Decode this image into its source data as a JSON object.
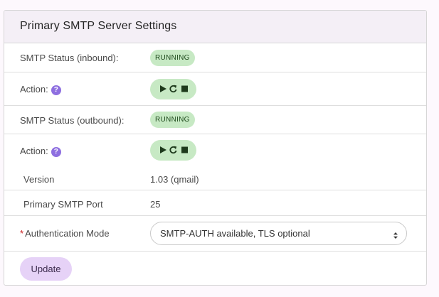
{
  "panel": {
    "title": "Primary SMTP Server Settings"
  },
  "rows": {
    "inbound": {
      "label": "SMTP Status (inbound):",
      "status": "RUNNING",
      "status_color": "#c7e9c4"
    },
    "inbound_action": {
      "label": "Action:",
      "help_glyph": "?",
      "icons": [
        "play-icon",
        "restart-icon",
        "stop-icon"
      ]
    },
    "outbound": {
      "label": "SMTP Status (outbound):",
      "status": "RUNNING",
      "status_color": "#c7e9c4"
    },
    "outbound_action": {
      "label": "Action:",
      "help_glyph": "?",
      "icons": [
        "play-icon",
        "restart-icon",
        "stop-icon"
      ]
    },
    "version": {
      "label": "Version",
      "value": "1.03 (qmail)"
    },
    "port": {
      "label": "Primary SMTP Port",
      "value": "25"
    },
    "auth": {
      "required_mark": "*",
      "label": "Authentication Mode",
      "selected": "SMTP-AUTH available, TLS optional"
    }
  },
  "footer": {
    "update_label": "Update"
  },
  "colors": {
    "accent": "#8e6fe0",
    "button": "#e6d2f7",
    "header_bg": "#f4eff6"
  }
}
